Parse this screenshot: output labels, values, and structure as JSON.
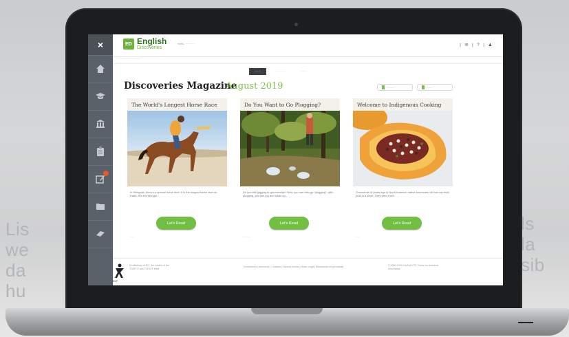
{
  "background_text": {
    "left_lines": [
      "Lis",
      "we",
      "da",
      "hu"
    ],
    "right_lines": [
      "ls",
      "la",
      "sib"
    ]
  },
  "sidebar": {
    "close_label": "×",
    "items": [
      {
        "icon": "home-icon"
      },
      {
        "icon": "graduation-cap-icon"
      },
      {
        "icon": "library-icon"
      },
      {
        "icon": "clipboard-icon"
      },
      {
        "icon": "edit-notification-icon",
        "badge": true
      },
      {
        "icon": "folder-icon"
      },
      {
        "icon": "book-icon"
      }
    ]
  },
  "header": {
    "logo_mark": "ED",
    "title": "English",
    "subtitle": "Discoveries",
    "greeting": "Hello, ··········",
    "icons": "| ✉ | ? | ♟"
  },
  "breadcrumb": "··········  ········ ··········",
  "tabs": [
    {
      "label": "·······",
      "active": true
    },
    {
      "label": "··········",
      "active": false
    },
    {
      "label": "·······",
      "active": false
    }
  ],
  "magazine": {
    "title": "Discoveries Magazine",
    "month": "August 2019",
    "btn1": "········",
    "btn2": "······"
  },
  "cards": [
    {
      "title": "The World's Longest Horse Race",
      "text": "In Mongolia, there's a special horse race. It is the longest horse race on Earth. It is the Mongol...",
      "button": "Let's Read",
      "tag": "······"
    },
    {
      "title": "Do You Want to Go Plogging?",
      "text": "Do you like jogging to get exercise? Now, you can also go \"plogging\": with plogging, you can jog and clean up...",
      "button": "Let's Read",
      "tag": "···········"
    },
    {
      "title": "Welcome to Indigenous Cooking",
      "text": "Thousands of years ago in North America, native Americans did not buy their food in a store. They grew their...",
      "button": "Let's Read",
      "tag": "······"
    }
  ],
  "footer": {
    "logo_label": "ELT",
    "left": "A subsidiary of ELT, the creator of the TOEFL® and TOEIC® tests",
    "center": "Condiciones | Acerca de | Contacto | Soporte técnico | Aviso Legal | Declaración de privacidad",
    "right": "© 2000-2019 EduSoft LTD. Todos los derechos reservados."
  }
}
